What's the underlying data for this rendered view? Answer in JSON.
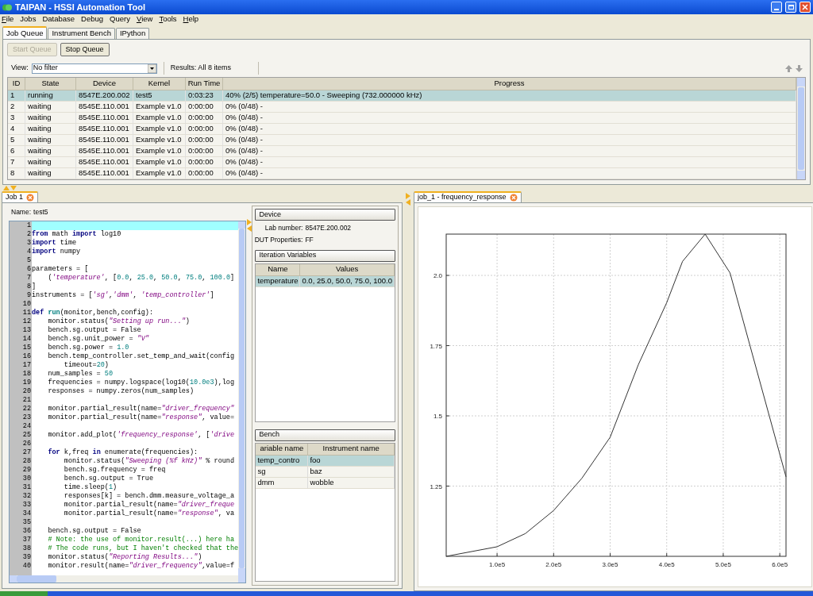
{
  "window": {
    "title": "TAIPAN - HSSI Automation Tool"
  },
  "menu": [
    {
      "label": "File",
      "underlined": true
    },
    {
      "label": "Jobs",
      "underlined": false
    },
    {
      "label": "Database",
      "underlined": false
    },
    {
      "label": "Debug",
      "underlined": false
    },
    {
      "label": "Query",
      "underlined": false
    },
    {
      "label": "View",
      "underlined": true
    },
    {
      "label": "Tools",
      "underlined": true
    },
    {
      "label": "Help",
      "underlined": true
    }
  ],
  "tabs": [
    {
      "label": "Job Queue",
      "selected": true
    },
    {
      "label": "Instrument Bench",
      "selected": false
    },
    {
      "label": "IPython",
      "selected": false
    }
  ],
  "toolbar": {
    "buttons": [
      {
        "label": "Start Queue",
        "disabled": true
      },
      {
        "label": "Stop Queue",
        "disabled": false
      }
    ],
    "view_label": "View:",
    "view_value": "No filter",
    "results": "Results: All 8 items"
  },
  "queue_table": {
    "columns": [
      "ID",
      "State",
      "Device",
      "Kernel",
      "Run Time",
      "Progress"
    ],
    "rows": [
      {
        "selected": true,
        "cells": [
          "1",
          "running",
          "8547E.200.002",
          "test5",
          "0:03:23",
          "40% (2/5)  temperature=50.0 - Sweeping (732.000000 kHz)"
        ]
      },
      {
        "selected": false,
        "cells": [
          "2",
          "waiting",
          "8545E.110.001",
          "Example v1.0",
          "0:00:00",
          "0% (0/48) -"
        ]
      },
      {
        "selected": false,
        "cells": [
          "3",
          "waiting",
          "8545E.110.001",
          "Example v1.0",
          "0:00:00",
          "0% (0/48) -"
        ]
      },
      {
        "selected": false,
        "cells": [
          "4",
          "waiting",
          "8545E.110.001",
          "Example v1.0",
          "0:00:00",
          "0% (0/48) -"
        ]
      },
      {
        "selected": false,
        "cells": [
          "5",
          "waiting",
          "8545E.110.001",
          "Example v1.0",
          "0:00:00",
          "0% (0/48) -"
        ]
      },
      {
        "selected": false,
        "cells": [
          "6",
          "waiting",
          "8545E.110.001",
          "Example v1.0",
          "0:00:00",
          "0% (0/48) -"
        ]
      },
      {
        "selected": false,
        "cells": [
          "7",
          "waiting",
          "8545E.110.001",
          "Example v1.0",
          "0:00:00",
          "0% (0/48) -"
        ]
      },
      {
        "selected": false,
        "cells": [
          "8",
          "waiting",
          "8545E.110.001",
          "Example v1.0",
          "0:00:00",
          "0% (0/48) -"
        ]
      }
    ]
  },
  "job_pane": {
    "tab": {
      "label": "Job 1",
      "selected": true
    },
    "name_label": "Name:",
    "name_value": "test5",
    "code": {
      "lines": [
        {
          "n": "1",
          "current": true
        },
        {
          "n": "2",
          "current": false,
          "tokens": [
            {
              "kind": "kw",
              "text": "from"
            },
            {
              "kind": "plain",
              "text": " math "
            },
            {
              "kind": "kw",
              "text": "import"
            },
            {
              "kind": "plain",
              "text": " log10"
            }
          ]
        },
        {
          "n": "3",
          "current": false,
          "tokens": [
            {
              "kind": "kw",
              "text": "import"
            },
            {
              "kind": "plain",
              "text": " time"
            }
          ]
        },
        {
          "n": "4",
          "current": false,
          "tokens": [
            {
              "kind": "kw",
              "text": "import"
            },
            {
              "kind": "plain",
              "text": " numpy"
            }
          ]
        },
        {
          "n": "5",
          "current": false
        },
        {
          "n": "6",
          "current": false,
          "tokens": [
            {
              "kind": "plain",
              "text": "parameters = ["
            }
          ]
        },
        {
          "n": "7",
          "current": false,
          "tokens": [
            {
              "kind": "plain",
              "text": "    ("
            },
            {
              "kind": "str",
              "text": "'temperature'"
            },
            {
              "kind": "plain",
              "text": ", ["
            },
            {
              "kind": "num",
              "text": "0.0"
            },
            {
              "kind": "plain",
              "text": ", "
            },
            {
              "kind": "num",
              "text": "25.0"
            },
            {
              "kind": "plain",
              "text": ", "
            },
            {
              "kind": "num",
              "text": "50.0"
            },
            {
              "kind": "plain",
              "text": ", "
            },
            {
              "kind": "num",
              "text": "75.0"
            },
            {
              "kind": "plain",
              "text": ", "
            },
            {
              "kind": "num",
              "text": "100.0"
            },
            {
              "kind": "plain",
              "text": "]"
            }
          ]
        },
        {
          "n": "8",
          "current": false,
          "tokens": [
            {
              "kind": "plain",
              "text": "]"
            }
          ]
        },
        {
          "n": "9",
          "current": false,
          "tokens": [
            {
              "kind": "plain",
              "text": "instruments = ["
            },
            {
              "kind": "str",
              "text": "'sg'"
            },
            {
              "kind": "plain",
              "text": ","
            },
            {
              "kind": "str",
              "text": "'dmm'"
            },
            {
              "kind": "plain",
              "text": ", "
            },
            {
              "kind": "str",
              "text": "'temp_controller'"
            },
            {
              "kind": "plain",
              "text": "]"
            }
          ]
        },
        {
          "n": "10",
          "current": false
        },
        {
          "n": "11",
          "current": false,
          "tokens": [
            {
              "kind": "kw",
              "text": "def"
            },
            {
              "kind": "fn",
              "text": " run"
            },
            {
              "kind": "plain",
              "text": "(monitor,bench,config):"
            }
          ]
        },
        {
          "n": "12",
          "current": false,
          "tokens": [
            {
              "kind": "plain",
              "text": "    monitor.status("
            },
            {
              "kind": "str",
              "text": "\"Setting up run...\""
            },
            {
              "kind": "plain",
              "text": ")"
            }
          ]
        },
        {
          "n": "13",
          "current": false,
          "tokens": [
            {
              "kind": "plain",
              "text": "    bench.sg.output = False"
            }
          ]
        },
        {
          "n": "14",
          "current": false,
          "tokens": [
            {
              "kind": "plain",
              "text": "    bench.sg.unit_power = "
            },
            {
              "kind": "str",
              "text": "\"V\""
            }
          ]
        },
        {
          "n": "15",
          "current": false,
          "tokens": [
            {
              "kind": "plain",
              "text": "    bench.sg.power = "
            },
            {
              "kind": "num",
              "text": "1.0"
            }
          ]
        },
        {
          "n": "16",
          "current": false,
          "tokens": [
            {
              "kind": "plain",
              "text": "    bench.temp_controller.set_temp_and_wait(config"
            }
          ]
        },
        {
          "n": "17",
          "current": false,
          "tokens": [
            {
              "kind": "plain",
              "text": "        timeout="
            },
            {
              "kind": "num",
              "text": "20"
            },
            {
              "kind": "plain",
              "text": ")"
            }
          ]
        },
        {
          "n": "18",
          "current": false,
          "tokens": [
            {
              "kind": "plain",
              "text": "    num_samples = "
            },
            {
              "kind": "num",
              "text": "50"
            }
          ]
        },
        {
          "n": "19",
          "current": false,
          "tokens": [
            {
              "kind": "plain",
              "text": "    frequencies = numpy.logspace(log10("
            },
            {
              "kind": "num",
              "text": "10.0e3"
            },
            {
              "kind": "plain",
              "text": "),log"
            }
          ]
        },
        {
          "n": "20",
          "current": false,
          "tokens": [
            {
              "kind": "plain",
              "text": "    responses = numpy.zeros(num_samples)"
            }
          ]
        },
        {
          "n": "21",
          "current": false
        },
        {
          "n": "22",
          "current": false,
          "tokens": [
            {
              "kind": "plain",
              "text": "    monitor.partial_result(name="
            },
            {
              "kind": "str",
              "text": "\"driver_frequency\""
            }
          ]
        },
        {
          "n": "23",
          "current": false,
          "tokens": [
            {
              "kind": "plain",
              "text": "    monitor.partial_result(name="
            },
            {
              "kind": "str",
              "text": "\"response\""
            },
            {
              "kind": "plain",
              "text": ", value="
            }
          ]
        },
        {
          "n": "24",
          "current": false
        },
        {
          "n": "25",
          "current": false,
          "tokens": [
            {
              "kind": "plain",
              "text": "    monitor.add_plot("
            },
            {
              "kind": "str",
              "text": "'frequency_response'"
            },
            {
              "kind": "plain",
              "text": ", ["
            },
            {
              "kind": "str",
              "text": "'drive"
            }
          ]
        },
        {
          "n": "26",
          "current": false
        },
        {
          "n": "27",
          "current": false,
          "tokens": [
            {
              "kind": "kw",
              "text": "    for"
            },
            {
              "kind": "plain",
              "text": " k,freq "
            },
            {
              "kind": "kw",
              "text": "in"
            },
            {
              "kind": "plain",
              "text": " enumerate(frequencies):"
            }
          ]
        },
        {
          "n": "28",
          "current": false,
          "tokens": [
            {
              "kind": "plain",
              "text": "        monitor.status("
            },
            {
              "kind": "str",
              "text": "\"Sweeping (%f kHz)\""
            },
            {
              "kind": "plain",
              "text": " % round"
            }
          ]
        },
        {
          "n": "29",
          "current": false,
          "tokens": [
            {
              "kind": "plain",
              "text": "        bench.sg.frequency = freq"
            }
          ]
        },
        {
          "n": "30",
          "current": false,
          "tokens": [
            {
              "kind": "plain",
              "text": "        bench.sg.output = True"
            }
          ]
        },
        {
          "n": "31",
          "current": false,
          "tokens": [
            {
              "kind": "plain",
              "text": "        time.sleep("
            },
            {
              "kind": "num",
              "text": "1"
            },
            {
              "kind": "plain",
              "text": ")"
            }
          ]
        },
        {
          "n": "32",
          "current": false,
          "tokens": [
            {
              "kind": "plain",
              "text": "        responses[k] = bench.dmm.measure_voltage_a"
            }
          ]
        },
        {
          "n": "33",
          "current": false,
          "tokens": [
            {
              "kind": "plain",
              "text": "        monitor.partial_result(name="
            },
            {
              "kind": "str",
              "text": "\"driver_freque"
            }
          ]
        },
        {
          "n": "34",
          "current": false,
          "tokens": [
            {
              "kind": "plain",
              "text": "        monitor.partial_result(name="
            },
            {
              "kind": "str",
              "text": "\"response\""
            },
            {
              "kind": "plain",
              "text": ", va"
            }
          ]
        },
        {
          "n": "35",
          "current": false
        },
        {
          "n": "36",
          "current": false,
          "tokens": [
            {
              "kind": "plain",
              "text": "    bench.sg.output = False"
            }
          ]
        },
        {
          "n": "37",
          "current": false,
          "tokens": [
            {
              "kind": "comment",
              "text": "    # Note: the use of monitor.result(...) here ha"
            }
          ]
        },
        {
          "n": "38",
          "current": false,
          "tokens": [
            {
              "kind": "comment",
              "text": "    # The code runs, but I haven't checked that the"
            }
          ]
        },
        {
          "n": "39",
          "current": false,
          "tokens": [
            {
              "kind": "plain",
              "text": "    monitor.status("
            },
            {
              "kind": "str",
              "text": "\"Reporting Results...\""
            },
            {
              "kind": "plain",
              "text": ")"
            }
          ]
        },
        {
          "n": "40",
          "current": false,
          "tokens": [
            {
              "kind": "plain",
              "text": "    monitor.result(name="
            },
            {
              "kind": "str",
              "text": "\"driver_frequency\""
            },
            {
              "kind": "plain",
              "text": ",value=f"
            }
          ]
        }
      ]
    }
  },
  "side_panel": {
    "device": {
      "title": "Device",
      "fields": [
        {
          "label": "Lab number:",
          "value": "8547E.200.002"
        },
        {
          "label": "DUT Properties:",
          "value": "FF"
        }
      ]
    },
    "iteration": {
      "title": "Iteration Variables",
      "columns": [
        "Name",
        "Values"
      ],
      "rows": [
        {
          "selected": true,
          "cells": [
            "temperature",
            "0.0, 25.0, 50.0, 75.0, 100.0"
          ]
        }
      ]
    },
    "bench": {
      "title": "Bench",
      "columns": [
        "ariable name",
        "Instrument name"
      ],
      "rows": [
        {
          "selected": true,
          "cells": [
            "temp_contro",
            "foo"
          ]
        },
        {
          "selected": false,
          "cells": [
            "sg",
            "baz"
          ]
        },
        {
          "selected": false,
          "cells": [
            "dmm",
            "wobble"
          ]
        }
      ]
    }
  },
  "plot_pane": {
    "tab": {
      "label": "job_1 - frequency_response",
      "selected": true
    },
    "chart_data": {
      "type": "line",
      "x": [
        10000,
        100000,
        150000,
        200000,
        250000,
        300000,
        350000,
        400000,
        428000,
        468000,
        512000,
        611000
      ],
      "grid": true,
      "series": [
        {
          "color": "#333333",
          "values": [
            1.0,
            1.034,
            1.081,
            1.163,
            1.278,
            1.424,
            1.683,
            1.903,
            2.05,
            2.147,
            2.009,
            1.283
          ]
        }
      ],
      "xlim": [
        10000,
        611000
      ],
      "ylim": [
        1.0,
        2.147
      ],
      "xticks": [
        {
          "value": 100000,
          "label": "1.0e5"
        },
        {
          "value": 200000,
          "label": "2.0e5"
        },
        {
          "value": 300000,
          "label": "3.0e5"
        },
        {
          "value": 400000,
          "label": "4.0e5"
        },
        {
          "value": 500000,
          "label": "5.0e5"
        },
        {
          "value": 600000,
          "label": "6.0e5"
        }
      ],
      "yticks": [
        {
          "value": 1.25,
          "label": "1.25"
        },
        {
          "value": 1.5,
          "label": "1.5"
        },
        {
          "value": 1.75,
          "label": "1.75"
        },
        {
          "value": 2.0,
          "label": "2.0"
        }
      ]
    }
  }
}
